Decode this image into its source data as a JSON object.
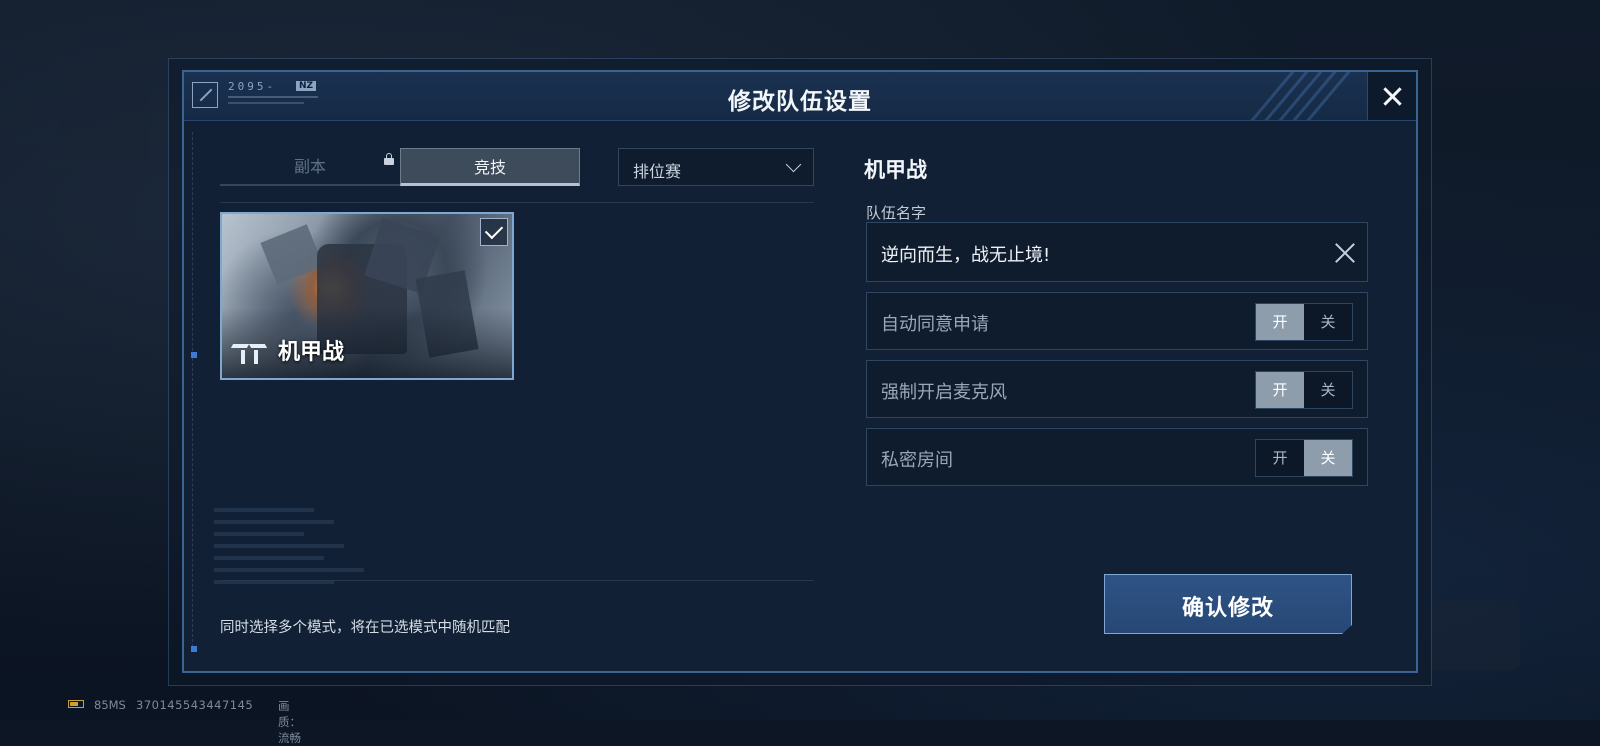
{
  "dialog": {
    "title": "修改队伍设置",
    "logo_text": "2095-",
    "logo_tag": "NZ"
  },
  "tabs": [
    {
      "label": "副本",
      "state": "locked"
    },
    {
      "label": "竞技",
      "state": "active"
    }
  ],
  "mode_select": {
    "value": "排位赛"
  },
  "mode_card": {
    "label": "机甲战",
    "selected": true
  },
  "hint": "同时选择多个模式，将在已选模式中随机匹配",
  "right_panel": {
    "title": "机甲战",
    "team_name_label": "队伍名字",
    "team_name_value": "逆向而生，战无止境!",
    "settings": [
      {
        "label": "自动同意申请",
        "on_label": "开",
        "off_label": "关",
        "value": "on"
      },
      {
        "label": "强制开启麦克风",
        "on_label": "开",
        "off_label": "关",
        "value": "on"
      },
      {
        "label": "私密房间",
        "on_label": "开",
        "off_label": "关",
        "value": "off"
      }
    ],
    "confirm_label": "确认修改"
  },
  "status_bar": {
    "ping": "85MS",
    "uid": "370145543447145",
    "quality": "画质：流畅"
  },
  "colors": {
    "accent": "#3a6494",
    "confirm": "#2e5385",
    "toggle_active": "#8e9dab"
  }
}
